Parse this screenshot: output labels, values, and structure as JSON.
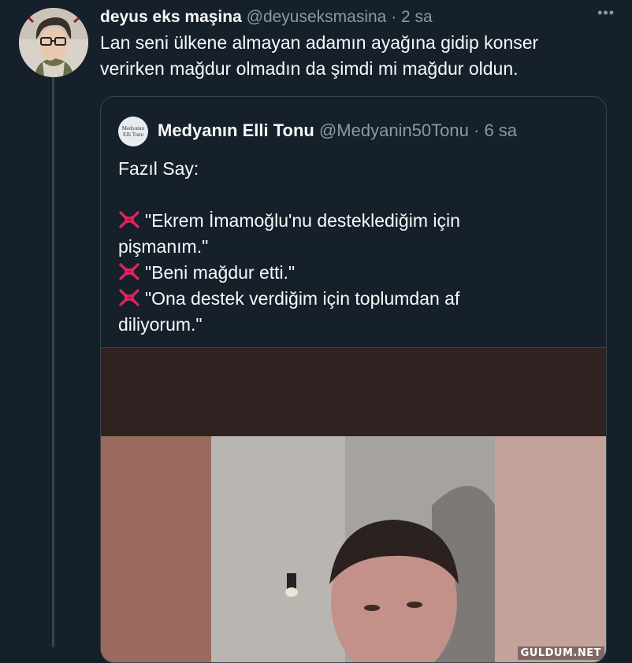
{
  "tweet": {
    "author_name": "deyus eks maşina",
    "author_handle": "@deyuseksmasina",
    "separator": "·",
    "time": "2 sa",
    "more": "•••",
    "text": "Lan seni ülkene almayan adamın ayağına gidip konser verirken mağdur olmadın da şimdi mi mağdur oldun."
  },
  "quote": {
    "avatar_text_line1": "Medyanın",
    "avatar_text_line2": "Elli Tonu",
    "author_name": "Medyanın Elli Tonu",
    "author_handle": "@Medyanin50Tonu",
    "separator": "·",
    "time": "6 sa",
    "lines": [
      "Fazıl Say:",
      "",
      "\"Ekrem İmamoğlu'nu desteklediğim için",
      "pişmanım.\"",
      "\"Beni mağdur etti.\"",
      "\"Ona destek verdiğim için toplumdan af",
      "diliyorum.\""
    ]
  },
  "watermark": "GULDUM.NET",
  "icons": {
    "anger": "anger-symbol-emoji",
    "more": "more-icon"
  },
  "colors": {
    "background": "#15202b",
    "border": "#38444d",
    "secondary_text": "#8b98a5",
    "primary_text": "#f7f9f9",
    "anger_red": "#e0245e"
  }
}
